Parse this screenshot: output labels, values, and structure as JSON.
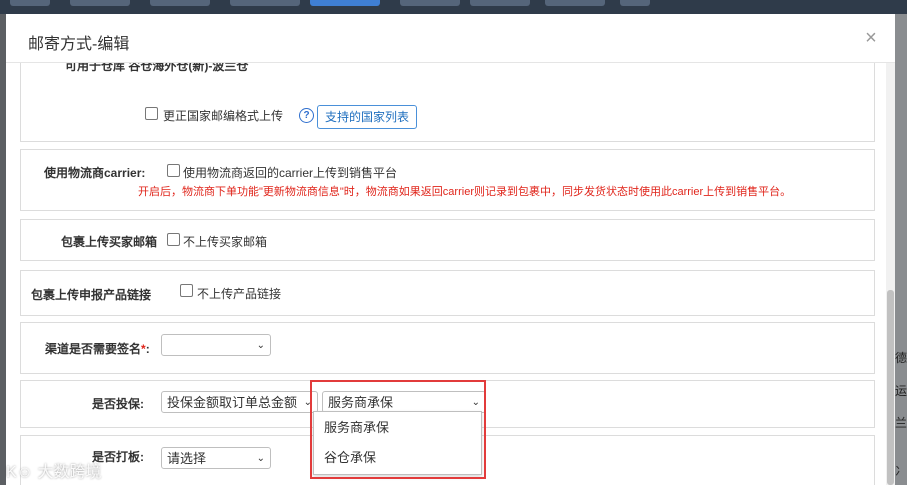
{
  "modal": {
    "title": "邮寄方式-编辑",
    "close_glyph": "×"
  },
  "sections": {
    "warehouse_line": "可用于仓库 谷仓海外仓(新)-波兰仓",
    "fix_postcode": {
      "checkbox_label": "更正国家邮编格式上传",
      "help_glyph": "?",
      "country_button": "支持的国家列表"
    },
    "carrier": {
      "label": "使用物流商carrier:",
      "checkbox_label": "使用物流商返回的carrier上传到销售平台",
      "note": "开启后，物流商下单功能\"更新物流商信息\"时，物流商如果返回carrier则记录到包裹中，同步发货状态时使用此carrier上传到销售平台。"
    },
    "buyer_email": {
      "label": "包裹上传买家邮箱",
      "checkbox_label": "不上传买家邮箱"
    },
    "product_link": {
      "label": "包裹上传申报产品链接",
      "checkbox_label": "不上传产品链接"
    },
    "signature": {
      "label": "渠道是否需要签名",
      "required_mark": "*",
      "label_suffix": ":",
      "value": ""
    },
    "insurance": {
      "label": "是否投保:",
      "amount_select": "投保金额取订单总金额",
      "provider_select": "服务商承保",
      "options": [
        "服务商承保",
        "谷仓承保"
      ]
    },
    "boarding": {
      "label": "是否打板:",
      "value": "请选择"
    }
  },
  "background_fragments": [
    "德",
    "运",
    "兰",
    "冫"
  ],
  "watermark": "大数跨境",
  "watermark_logo": "K☺"
}
